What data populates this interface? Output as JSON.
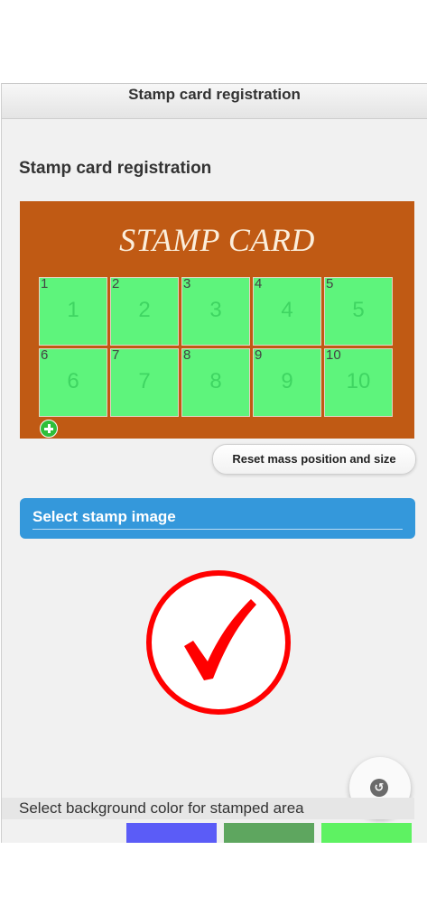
{
  "header": {
    "title": "Stamp card registration"
  },
  "page": {
    "title": "Stamp card registration"
  },
  "card": {
    "title": "STAMP CARD",
    "background": "#c05a14",
    "cell_color": "#5ef47c",
    "cells": [
      {
        "tag": "1",
        "num": "1"
      },
      {
        "tag": "2",
        "num": "2"
      },
      {
        "tag": "3",
        "num": "3"
      },
      {
        "tag": "4",
        "num": "4"
      },
      {
        "tag": "5",
        "num": "5"
      },
      {
        "tag": "6",
        "num": "6"
      },
      {
        "tag": "7",
        "num": "7"
      },
      {
        "tag": "8",
        "num": "8"
      },
      {
        "tag": "9",
        "num": "9"
      },
      {
        "tag": "10",
        "num": "10"
      }
    ]
  },
  "actions": {
    "reset_label": "Reset mass position and size",
    "select_stamp_label": "Select stamp image",
    "add_icon": "plus-circle-icon",
    "fab_icon": "refresh-icon"
  },
  "stamp": {
    "icon": "checkmark-circle-icon",
    "color": "#ff0000"
  },
  "background_color": {
    "label": "Select background color for stamped area",
    "swatches": [
      "#5b5cf7",
      "#5ea65f",
      "#5ef262"
    ]
  }
}
